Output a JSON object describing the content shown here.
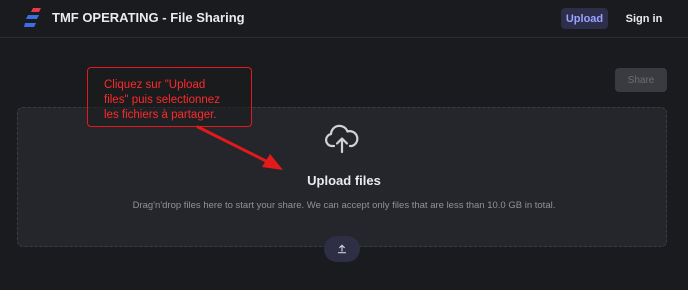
{
  "header": {
    "title": "TMF OPERATING - File Sharing",
    "nav_upload": "Upload",
    "nav_signin": "Sign in"
  },
  "share_button": "Share",
  "dropzone": {
    "title": "Upload files",
    "description": "Drag'n'drop files here to start your share. We can accept only files that are less than 10.0 GB in total."
  },
  "annotation": {
    "line1": "Cliquez sur \"Upload",
    "line2": "files\" puis selectionnez",
    "line3": "les fichiers à partager."
  },
  "colors": {
    "background": "#1a1b1e",
    "accent": "#9aa3ff",
    "annotation": "#e21a1a"
  },
  "icons": {
    "logo": "tmf-logo-icon",
    "upload_cloud": "cloud-upload-icon",
    "upload_arrow": "upload-arrow-icon"
  }
}
